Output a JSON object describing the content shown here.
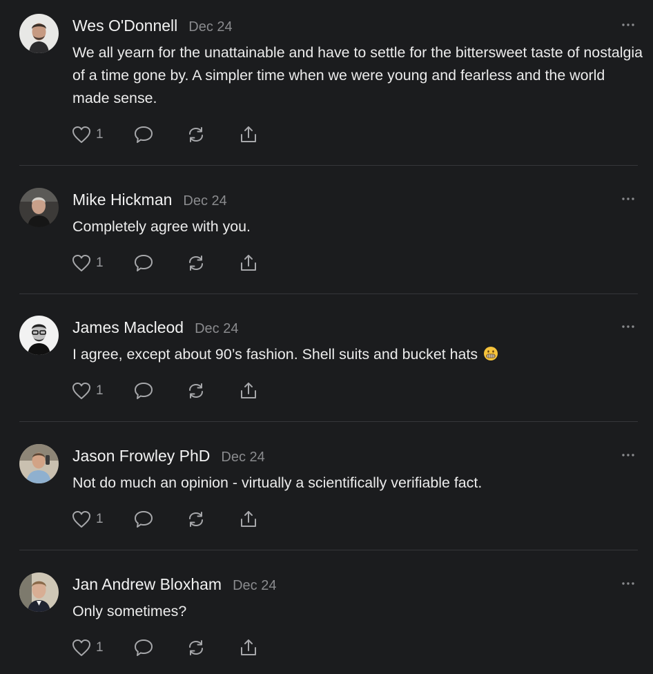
{
  "comments": [
    {
      "author": "Wes O'Donnell",
      "date": "Dec 24",
      "text": "We all yearn for the unattainable and have to settle for the bittersweet taste of nostalgia of a time gone by. A simpler time when we were young and fearless and the world made sense.",
      "likes": "1"
    },
    {
      "author": "Mike Hickman",
      "date": "Dec 24",
      "text": "Completely agree with you.",
      "likes": "1"
    },
    {
      "author": "James Macleod",
      "date": "Dec 24",
      "text": "I agree, except about 90’s fashion. Shell suits and bucket hats",
      "emoji": "grimacing-face",
      "likes": "1"
    },
    {
      "author": "Jason Frowley PhD",
      "date": "Dec 24",
      "text": "Not do much an opinion - virtually a scientifically verifiable fact.",
      "likes": "1"
    },
    {
      "author": "Jan Andrew Bloxham",
      "date": "Dec 24",
      "text": "Only sometimes?",
      "likes": "1"
    }
  ],
  "icons": {
    "like": "heart-icon",
    "reply": "speech-bubble-icon",
    "restack": "restack-arrows-icon",
    "share": "share-upload-icon",
    "more": "ellipsis-icon"
  },
  "colors": {
    "background": "#1b1c1e",
    "text": "#ececec",
    "muted": "#8a8b8e",
    "divider": "#36373a"
  }
}
